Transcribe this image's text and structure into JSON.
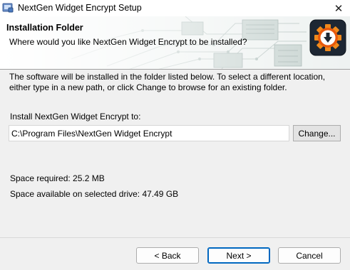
{
  "window": {
    "title": "NextGen Widget Encrypt Setup",
    "close_glyph": "✕",
    "app_icon": "installer-icon"
  },
  "header": {
    "title": "Installation Folder",
    "subtitle": "Where would you like NextGen Widget Encrypt to be installed?",
    "badge_icon": "download-gear-icon",
    "badge_color": "#e8590c"
  },
  "main": {
    "description": "The software will be installed in the folder listed below. To select a different location, either type in a new path, or click Change to browse for an existing folder.",
    "install_label": "Install NextGen Widget Encrypt to:",
    "install_path": "C:\\Program Files\\NextGen Widget Encrypt",
    "change_label": "Change...",
    "space_required": "Space required: 25.2 MB",
    "space_available": "Space available on selected drive: 47.49 GB"
  },
  "footer": {
    "back_label": "< Back",
    "next_label": "Next >",
    "cancel_label": "Cancel",
    "accent_color": "#0067c0"
  }
}
